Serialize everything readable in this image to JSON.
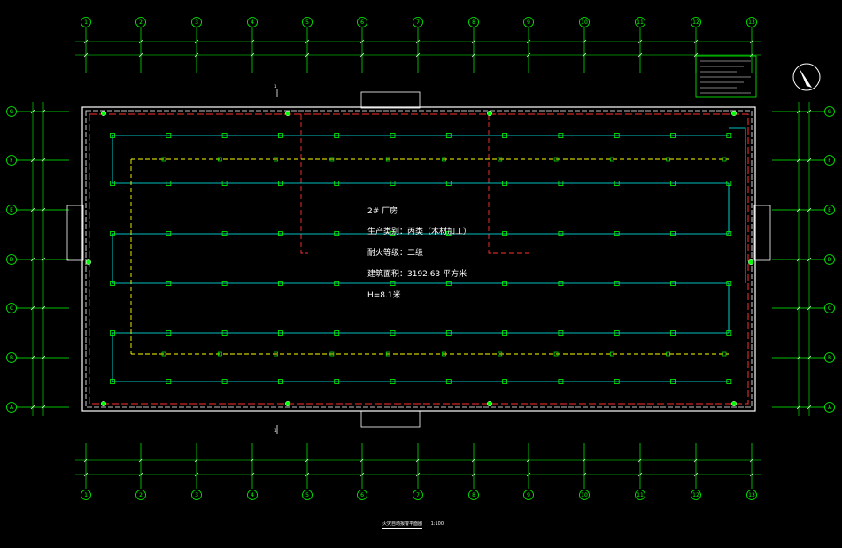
{
  "drawing": {
    "title": "火灾自动报警平面图",
    "scale": "1:100",
    "building_info": {
      "name": "2# 厂房",
      "production_category": "生产类别：丙类（木材加工）",
      "fire_rating": "耐火等级：二级",
      "floor_area": "建筑面积：3192.63 平方米",
      "height": "H=8.1米"
    },
    "grid_columns": [
      "1",
      "2",
      "3",
      "4",
      "5",
      "6",
      "7",
      "8",
      "9",
      "10",
      "11",
      "12",
      "13"
    ],
    "grid_rows": [
      "G",
      "F",
      "E",
      "D",
      "C",
      "B",
      "A"
    ],
    "section_mark": "1",
    "colors": {
      "grid": "#00ff00",
      "wall": "#ffffff",
      "smoke_detector_loop": "#00ffff",
      "alarm_loop": "#ff3030",
      "linkage_loop": "#ffff00"
    },
    "icons": [
      "north-arrow-icon",
      "smoke-detector-icon",
      "manual-call-point-icon",
      "section-marker-icon"
    ]
  }
}
